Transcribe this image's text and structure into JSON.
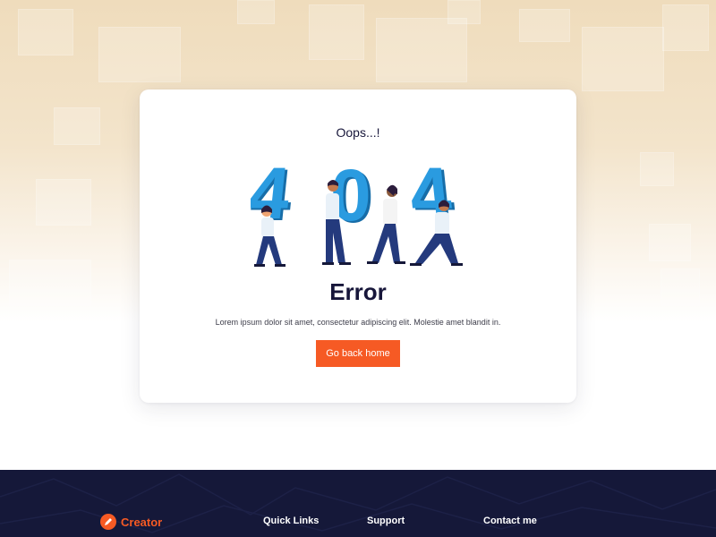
{
  "error_card": {
    "eyebrow": "Oops...!",
    "title": "Error",
    "description": "Lorem ipsum dolor sit amet, consectetur adipiscing elit. Molestie amet blandit in.",
    "button_label": "Go back home",
    "illustration_digits": [
      "4",
      "0",
      "4"
    ]
  },
  "footer": {
    "brand": "Creator",
    "headings": [
      "Quick Links",
      "Support",
      "Contact me"
    ]
  },
  "colors": {
    "accent": "#f65a24",
    "footer_bg": "#151839",
    "heading": "#17163a",
    "digit_blue": "#1f8fd1"
  }
}
